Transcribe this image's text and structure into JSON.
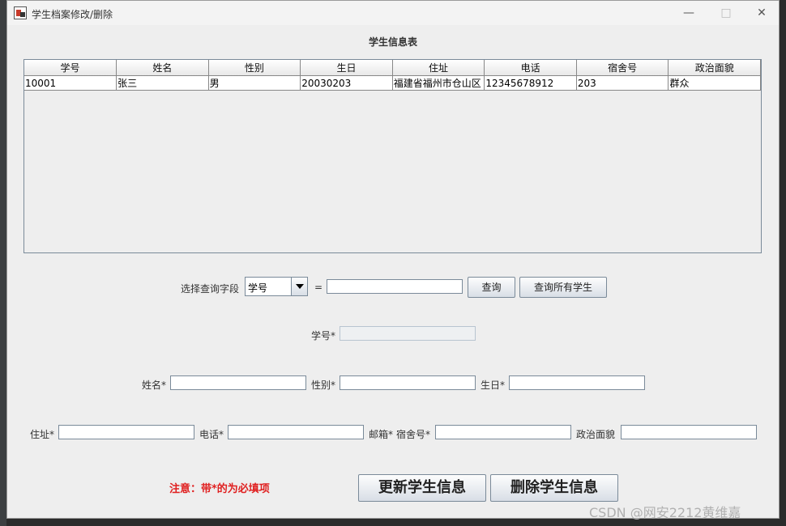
{
  "window": {
    "title": "学生档案修改/删除"
  },
  "table": {
    "caption": "学生信息表",
    "columns": [
      "学号",
      "姓名",
      "性别",
      "生日",
      "住址",
      "电话",
      "宿舍号",
      "政治面貌"
    ],
    "rows": [
      [
        "10001",
        "张三",
        "男",
        "20030203",
        "福建省福州市仓山区",
        "12345678912",
        "203",
        "群众"
      ]
    ]
  },
  "query": {
    "field_label": "选择查询字段",
    "selected_field": "学号",
    "equals": "=",
    "value": "",
    "search_button": "查询",
    "search_all_button": "查询所有学生"
  },
  "form": {
    "id_label": "学号*",
    "name_label": "姓名*",
    "gender_label": "性别*",
    "birthday_label": "生日*",
    "address_label": "住址*",
    "phone_label": "电话*",
    "email_label": "邮箱*",
    "dorm_label": "宿舍号*",
    "political_label": "政治面貌"
  },
  "note": "注意：带*的为必填项",
  "buttons": {
    "update": "更新学生信息",
    "delete": "删除学生信息"
  },
  "watermark": "CSDN @网安2212黄维嘉"
}
